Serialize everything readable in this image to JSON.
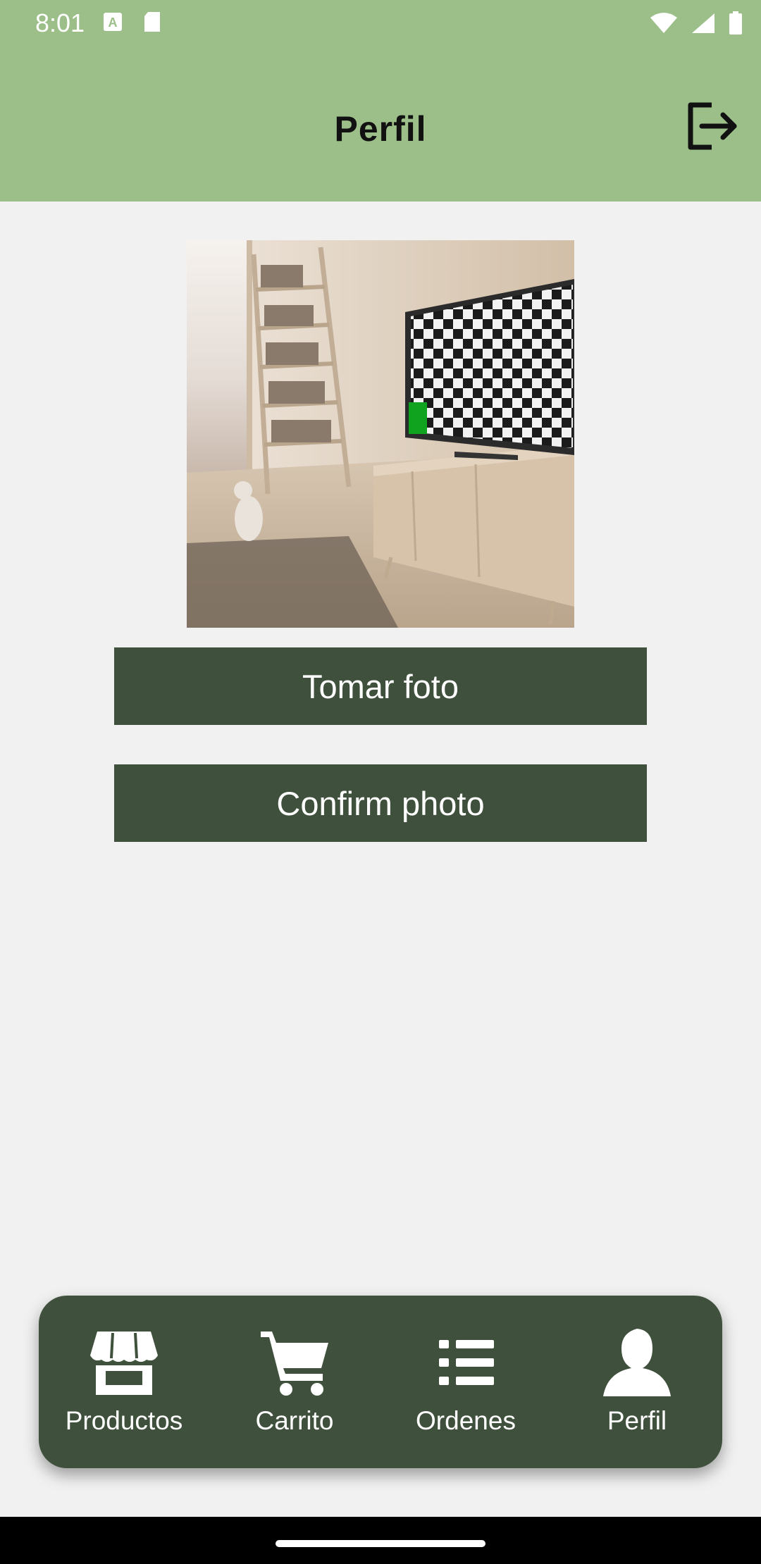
{
  "status_bar": {
    "time": "8:01"
  },
  "app_bar": {
    "title": "Perfil",
    "logout_icon": "logout-icon"
  },
  "profile": {
    "photo_icon": "room-with-tv-photo",
    "take_photo_label": "Tomar foto",
    "confirm_photo_label": "Confirm photo"
  },
  "bottom_nav": {
    "items": [
      {
        "label": "Productos",
        "icon": "store-icon"
      },
      {
        "label": "Carrito",
        "icon": "cart-icon"
      },
      {
        "label": "Ordenes",
        "icon": "list-icon"
      },
      {
        "label": "Perfil",
        "icon": "person-icon"
      }
    ]
  },
  "colors": {
    "app_bar": "#9cbf8a",
    "button": "#3f513c",
    "nav": "#3f513c",
    "background": "#f1f1f1"
  }
}
